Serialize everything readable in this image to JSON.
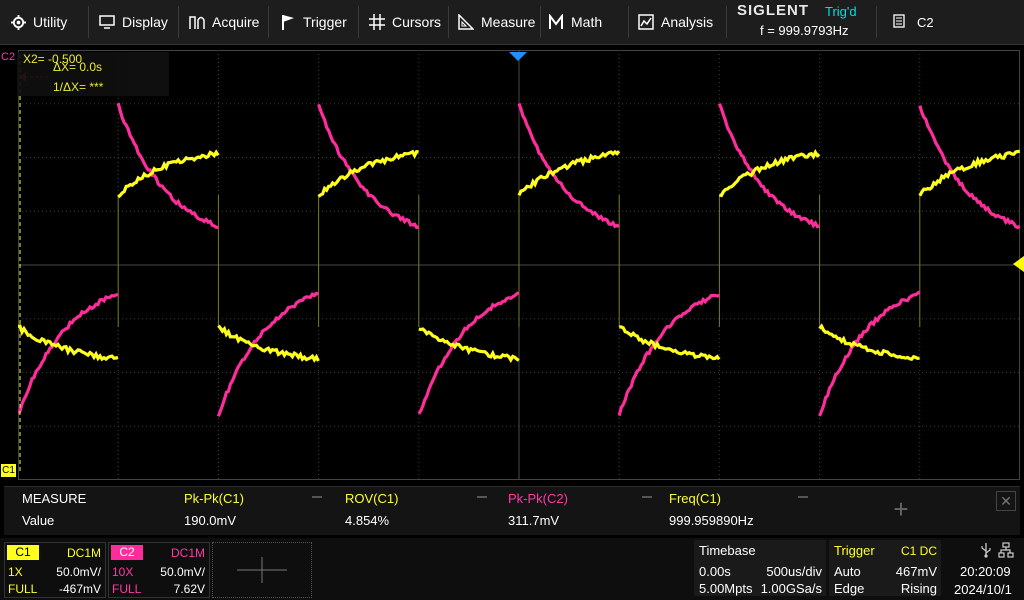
{
  "menu": [
    {
      "label": "Utility",
      "icon": "gear-icon"
    },
    {
      "label": "Display",
      "icon": "monitor-icon"
    },
    {
      "label": "Acquire",
      "icon": "acquire-wave-icon"
    },
    {
      "label": "Trigger",
      "icon": "flag-icon"
    },
    {
      "label": "Cursors",
      "icon": "crosshair-icon"
    },
    {
      "label": "Measure",
      "icon": "ruler-icon"
    },
    {
      "label": "Math",
      "icon": "math-m-icon"
    },
    {
      "label": "Analysis",
      "icon": "analysis-chart-icon"
    }
  ],
  "brand": "SIGLENT",
  "trigger_status": "Trig'd",
  "frequency": "f = 999.9793Hz",
  "active_channel": "C2",
  "cursor": {
    "x2_label": "X2= -0.500",
    "delta_x": "ΔX= 0.0s",
    "inv_delta_x": "1/ΔX= ***"
  },
  "markers": {
    "c1": "C1",
    "c2": "C2"
  },
  "colors": {
    "ch1": "#ffff1e",
    "ch2": "#ff2d9b",
    "grid": "#3c3c3c",
    "trigger": "#ffff00"
  },
  "measure": {
    "title": "MEASURE",
    "row_label": "Value",
    "columns": [
      {
        "name": "Pk-Pk(C1)",
        "value": "190.0mV",
        "color": "#ffff33"
      },
      {
        "name": "ROV(C1)",
        "value": "4.854%",
        "color": "#ffff33"
      },
      {
        "name": "Pk-Pk(C2)",
        "value": "311.7mV",
        "color": "#ff3aa8"
      },
      {
        "name": "Freq(C1)",
        "value": "999.959890Hz",
        "color": "#ffff33"
      }
    ],
    "add_label": "+",
    "close_label": "✕"
  },
  "ch1": {
    "name": "C1",
    "coupling": "DC1M",
    "probe": "1X",
    "scale": "50.0mV/",
    "bw": "FULL",
    "offset": "-467mV"
  },
  "ch2": {
    "name": "C2",
    "coupling": "DC1M",
    "probe": "10X",
    "scale": "50.0mV/",
    "bw": "FULL",
    "offset": "7.62V"
  },
  "timebase": {
    "title": "Timebase",
    "delay": "0.00s",
    "scale": "500us/div",
    "memory": "5.00Mpts",
    "rate": "1.00GSa/s"
  },
  "trigger": {
    "title": "Trigger",
    "source": "C1 DC",
    "mode": "Auto",
    "level": "467mV",
    "type": "Edge",
    "slope": "Rising"
  },
  "clock": {
    "time": "20:20:09",
    "date": "2024/10/1"
  }
}
